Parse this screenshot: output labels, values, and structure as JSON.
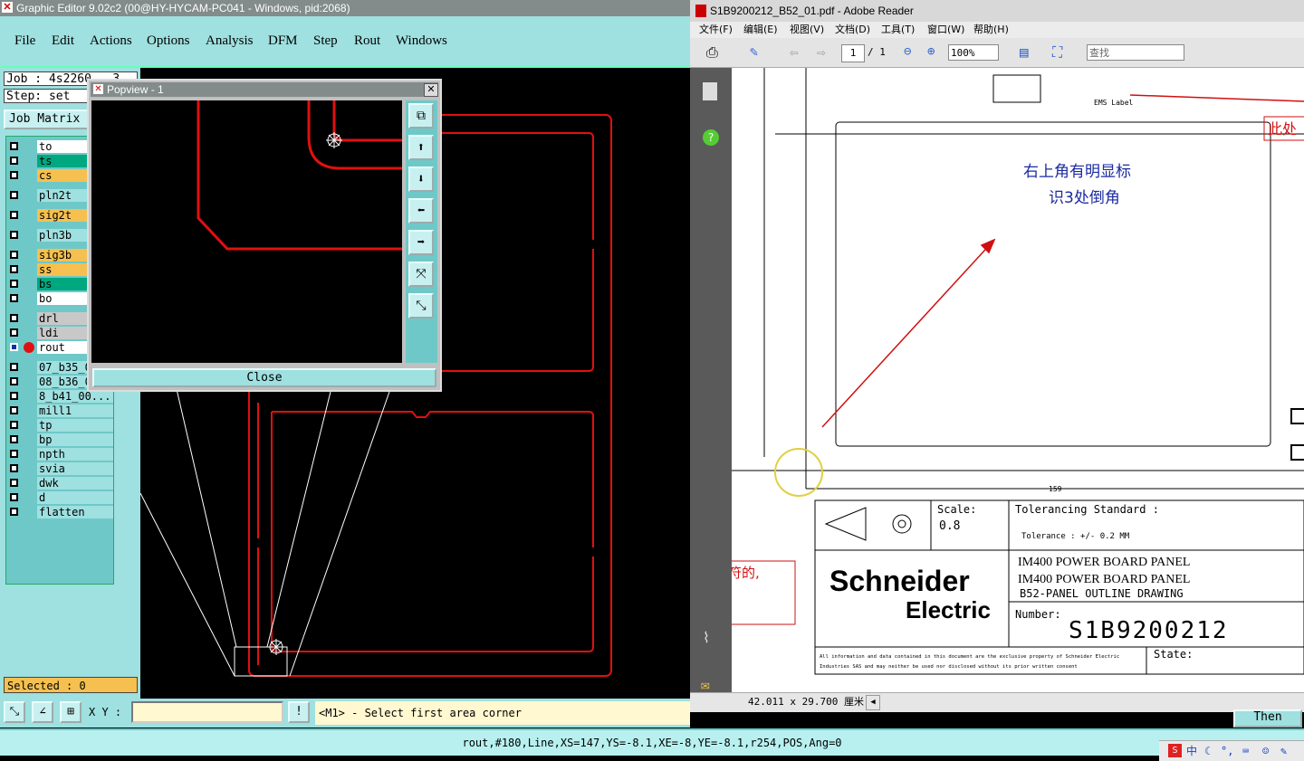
{
  "graphic_editor": {
    "title": "Graphic Editor 9.02c2 (00@HY-HYCAM-PC041 - Windows, pid:2068)",
    "menu": [
      "File",
      "Edit",
      "Actions",
      "Options",
      "Analysis",
      "DFM",
      "Step",
      "Rout",
      "Windows"
    ],
    "job_label": "Job : 4s2260...3",
    "step_label": "Step: set",
    "job_matrix_label": "Job Matrix",
    "layers": [
      {
        "name": "to",
        "color": "#ffffff"
      },
      {
        "name": "ts",
        "color": "#00a880"
      },
      {
        "name": "cs",
        "color": "#f5c050"
      },
      {
        "name": "pln2t",
        "color": "#9fe0e0"
      },
      {
        "name": "sig2t",
        "color": "#f5c050"
      },
      {
        "name": "pln3b",
        "color": "#9fe0e0"
      },
      {
        "name": "sig3b",
        "color": "#f5c050"
      },
      {
        "name": "ss",
        "color": "#f5c050"
      },
      {
        "name": "bs",
        "color": "#00a880"
      },
      {
        "name": "bo",
        "color": "#ffffff"
      },
      {
        "name": "drl",
        "color": "#c8c8c8"
      },
      {
        "name": "ldi",
        "color": "#c8c8c8"
      },
      {
        "name": "rout",
        "color": "#ffffff"
      },
      {
        "name": "07_b35_0...",
        "color": "#9fe0e0"
      },
      {
        "name": "08_b36_0...",
        "color": "#9fe0e0"
      },
      {
        "name": "8_b41_00...",
        "color": "#9fe0e0"
      },
      {
        "name": "mill1",
        "color": "#9fe0e0"
      },
      {
        "name": "tp",
        "color": "#9fe0e0"
      },
      {
        "name": "bp",
        "color": "#9fe0e0"
      },
      {
        "name": "npth",
        "color": "#9fe0e0"
      },
      {
        "name": "svia",
        "color": "#9fe0e0"
      },
      {
        "name": "dwk",
        "color": "#9fe0e0"
      },
      {
        "name": "d",
        "color": "#9fe0e0"
      },
      {
        "name": "flatten",
        "color": "#9fe0e0"
      }
    ],
    "selected_label": "Selected : 0",
    "xy_label": "X Y :",
    "xy_value": "",
    "prompt": "<M1> - Select first area corner",
    "then_label": "Then",
    "status": "rout,#180,Line,XS=147,YS=-8.1,XE=-8,YE=-8.1,r254,POS,Ang=0"
  },
  "popview": {
    "title": "Popview - 1",
    "close_label": "Close"
  },
  "adobe_reader": {
    "title": "S1B9200212_B52_01.pdf - Adobe Reader",
    "menu": [
      "文件(F)",
      "编辑(E)",
      "视图(V)",
      "文档(D)",
      "工具(T)",
      "窗口(W)",
      "帮助(H)"
    ],
    "page_current": "1",
    "page_total": "/ 1",
    "zoom": "100%",
    "search_placeholder": "查找",
    "page_size": "42.011 x 29.700 厘米",
    "drawing": {
      "ems_label": "EMS Label",
      "annotation_top_right": "此处",
      "annotation_main_line1": "右上角有明显标",
      "annotation_main_line2": "识3处倒角",
      "annotation_left": "符的,",
      "dimension": "159",
      "scale_label": "Scale:",
      "scale_value": "0.8",
      "tolerancing_label": "Tolerancing Standard :",
      "tolerance": "Tolerance : +/- 0.2 MM",
      "company_line1": "Schneider",
      "company_line2": "Electric",
      "title_line1": "IM400 POWER BOARD PANEL",
      "title_line2": "IM400 POWER BOARD PANEL",
      "title_line3": "B52-PANEL OUTLINE DRAWING",
      "number_label": "Number:",
      "number_value": "S1B9200212",
      "state_label": "State:",
      "disclaimer_line1": "All information and data contained in this document are the exclusive property of Schneider Electric",
      "disclaimer_line2": "Industries SAS and may neither be used nor disclosed without its prior written consent"
    }
  },
  "taskbar": {
    "ime": "中"
  }
}
